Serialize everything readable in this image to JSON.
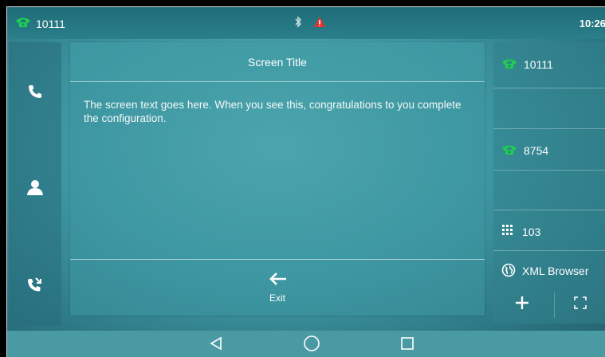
{
  "statusbar": {
    "line_number": "10111",
    "time": "10:26",
    "icons": [
      "phone-icon",
      "bluetooth-icon",
      "alert-icon"
    ]
  },
  "sidebar": {
    "items": [
      {
        "icon": "phone-icon"
      },
      {
        "icon": "contact-icon"
      },
      {
        "icon": "call-history-icon"
      }
    ]
  },
  "panel": {
    "title": "Screen Title",
    "text": "The screen text goes here. When you see this, congratulations to you complete the configuration.",
    "exit_label": "Exit"
  },
  "rightpanel": {
    "items": [
      {
        "label": "10111",
        "icon": "phone-icon"
      },
      {
        "label": "8754",
        "icon": "phone-icon"
      },
      {
        "label": "103",
        "icon": "dialpad-icon"
      },
      {
        "label": "XML Browser",
        "icon": "globe-icon"
      }
    ],
    "add_icon": "plus-icon",
    "expand_icon": "expand-icon"
  },
  "navbar": {
    "icons": [
      "back-icon",
      "home-icon",
      "recent-apps-icon"
    ]
  },
  "colors": {
    "line_green": "#1fd14a",
    "alert_red": "#e2342b"
  }
}
